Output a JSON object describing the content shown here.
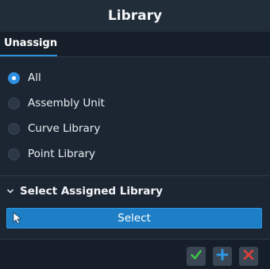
{
  "window": {
    "title": "Library"
  },
  "tabs": [
    {
      "label": "Unassign",
      "active": true
    }
  ],
  "options": [
    {
      "label": "All",
      "checked": true
    },
    {
      "label": "Assembly Unit",
      "checked": false
    },
    {
      "label": "Curve Library",
      "checked": false
    },
    {
      "label": "Point Library",
      "checked": false
    }
  ],
  "section": {
    "title": "Select Assigned Library",
    "expanded": true
  },
  "select_button": {
    "label": "Select",
    "icon": "cursor-arrow-icon"
  },
  "footer": {
    "buttons": [
      {
        "icon": "check-icon",
        "color": "#3ec44a"
      },
      {
        "icon": "plus-icon",
        "color": "#2e9be6"
      },
      {
        "icon": "close-icon",
        "color": "#e2403a"
      }
    ]
  },
  "colors": {
    "accent": "#2e8fe0",
    "panel_bg": "#1c2632",
    "button_bg": "#1e7fc6"
  }
}
